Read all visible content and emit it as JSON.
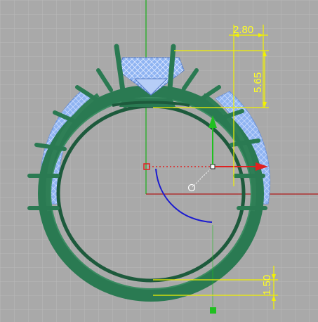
{
  "viewport": {
    "background": "#a9a9a9",
    "grid_color": "#b8b8b8",
    "axis_x_color": "#b01a1a",
    "axis_y_color": "#18b018"
  },
  "model": {
    "ring_color": "#2a7a52",
    "ring_dark": "#1d5a3c",
    "gem_color": "#8fb4f2",
    "gem_highlight": "#cfe0ff"
  },
  "dimensions": {
    "color": "#f2f200",
    "top_width": "2.80",
    "height": "5.65",
    "bottom_thickness": "1.50"
  },
  "gumball": {
    "x_axis_color": "#e02020",
    "y_axis_color": "#20c020",
    "rotate_arc_color": "#1a1ad0",
    "center_marker": "#e02020"
  }
}
